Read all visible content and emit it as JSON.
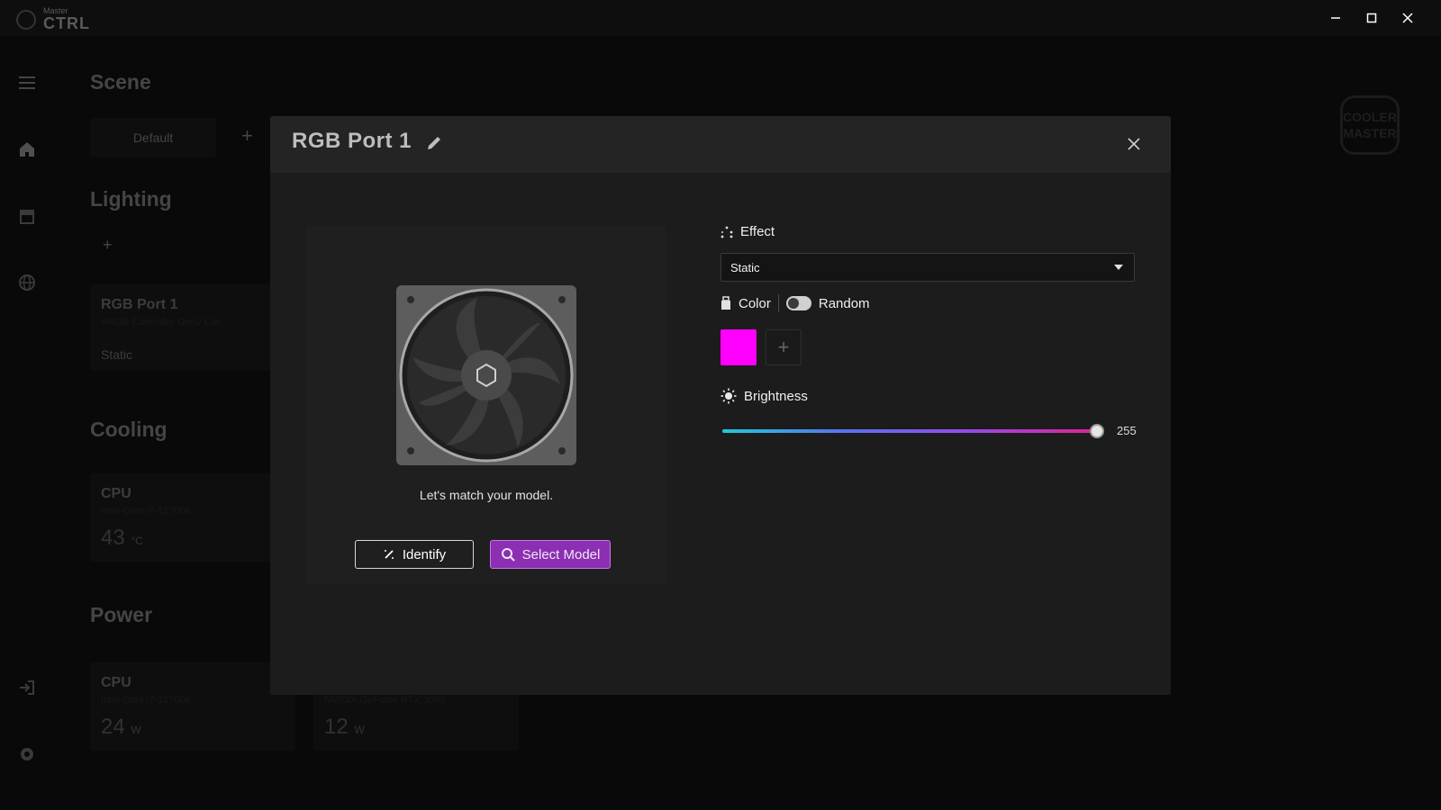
{
  "app": {
    "brand_small": "Master",
    "brand_big": "CTRL"
  },
  "window_controls": {
    "minimize": "—",
    "maximize": "☐",
    "close": "✕"
  },
  "background": {
    "scene_title": "Scene",
    "scene_tab": "Default",
    "lighting_title": "Lighting",
    "lighting_card": {
      "title": "RGB Port 1",
      "subtitle": "ARGB Controller Gen2 Lite",
      "status": "Static"
    },
    "cooling_title": "Cooling",
    "cooling_card": {
      "title": "CPU",
      "subtitle": "Intel Core i7-12700K",
      "value": "43",
      "unit": "°C"
    },
    "power_title": "Power",
    "power_cards": [
      {
        "title": "CPU",
        "subtitle": "Intel Core i7-12700K",
        "value": "24",
        "unit": "W"
      },
      {
        "title": "",
        "subtitle": "NVIDIA GeForce RTX 3060",
        "value": "12",
        "unit": "W"
      }
    ],
    "logo_text": "COOLER MASTER"
  },
  "modal": {
    "title": "RGB Port 1",
    "match_text": "Let's match your model.",
    "identify_label": "Identify",
    "select_model_label": "Select Model",
    "effect_label": "Effect",
    "effect_value": "Static",
    "color_label": "Color",
    "random_label": "Random",
    "random_enabled": false,
    "selected_color": "#ff00ff",
    "brightness_label": "Brightness",
    "brightness_value": "255",
    "brightness_fraction": 1.0
  },
  "icons": {
    "menu": "menu-icon",
    "home": "home-icon",
    "devices": "devices-icon",
    "globe": "globe-icon",
    "logout": "logout-icon",
    "settings": "settings-icon",
    "edit": "edit-icon",
    "close": "close-icon",
    "sparkle": "sparkle-icon",
    "search": "search-icon",
    "brightness": "sun-icon",
    "color": "bucket-icon"
  }
}
